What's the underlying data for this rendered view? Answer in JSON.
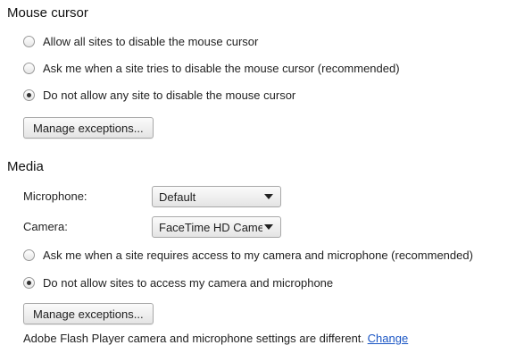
{
  "mouse_cursor": {
    "title": "Mouse cursor",
    "options": [
      {
        "label": "Allow all sites to disable the mouse cursor",
        "checked": false
      },
      {
        "label": "Ask me when a site tries to disable the mouse cursor (recommended)",
        "checked": false
      },
      {
        "label": "Do not allow any site to disable the mouse cursor",
        "checked": true
      }
    ],
    "manage_button": "Manage exceptions..."
  },
  "media": {
    "title": "Media",
    "microphone_label": "Microphone:",
    "microphone_value": "Default",
    "camera_label": "Camera:",
    "camera_value": "FaceTime HD Camera",
    "options": [
      {
        "label": "Ask me when a site requires access to my camera and microphone (recommended)",
        "checked": false
      },
      {
        "label": "Do not allow sites to access my camera and microphone",
        "checked": true
      }
    ],
    "manage_button": "Manage exceptions...",
    "flash_note": "Adobe Flash Player camera and microphone settings are different.",
    "change_link": "Change"
  }
}
